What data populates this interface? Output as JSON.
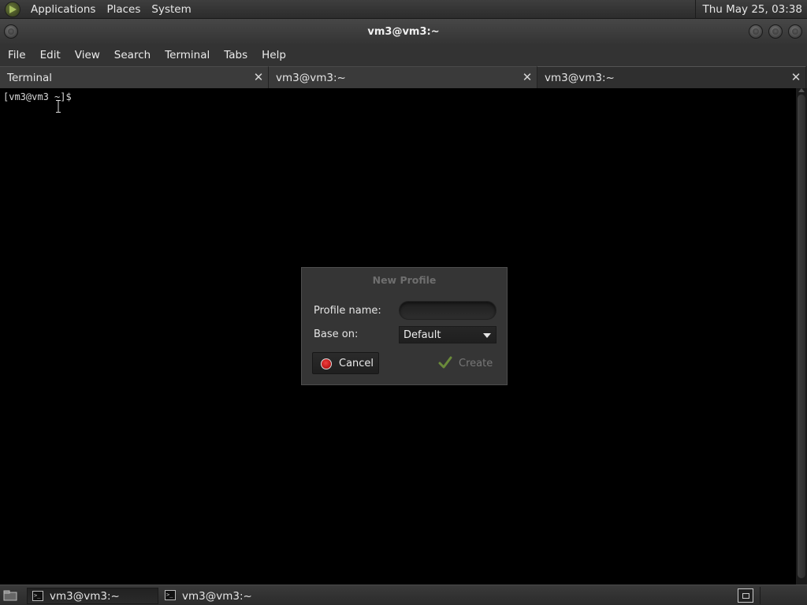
{
  "top_panel": {
    "menus": [
      "Applications",
      "Places",
      "System"
    ],
    "clock": "Thu May 25, 03:38"
  },
  "window": {
    "title": "vm3@vm3:~"
  },
  "menubar": [
    "File",
    "Edit",
    "View",
    "Search",
    "Terminal",
    "Tabs",
    "Help"
  ],
  "tabs": [
    {
      "label": "Terminal"
    },
    {
      "label": "vm3@vm3:~"
    },
    {
      "label": "vm3@vm3:~"
    }
  ],
  "terminal": {
    "prompt": "[vm3@vm3 ~]$"
  },
  "dialog": {
    "title": "New Profile",
    "profile_name_label": "Profile name:",
    "profile_name_value": "",
    "base_on_label": "Base on:",
    "base_on_value": "Default",
    "cancel_label": "Cancel",
    "create_label": "Create"
  },
  "taskbar": {
    "tasks": [
      {
        "label": "vm3@vm3:~"
      },
      {
        "label": "vm3@vm3:~"
      }
    ]
  },
  "colors": {
    "background": "#000000",
    "panel": "#333333",
    "cancel_icon": "#cc1111",
    "create_check": "#6a8a3a"
  }
}
